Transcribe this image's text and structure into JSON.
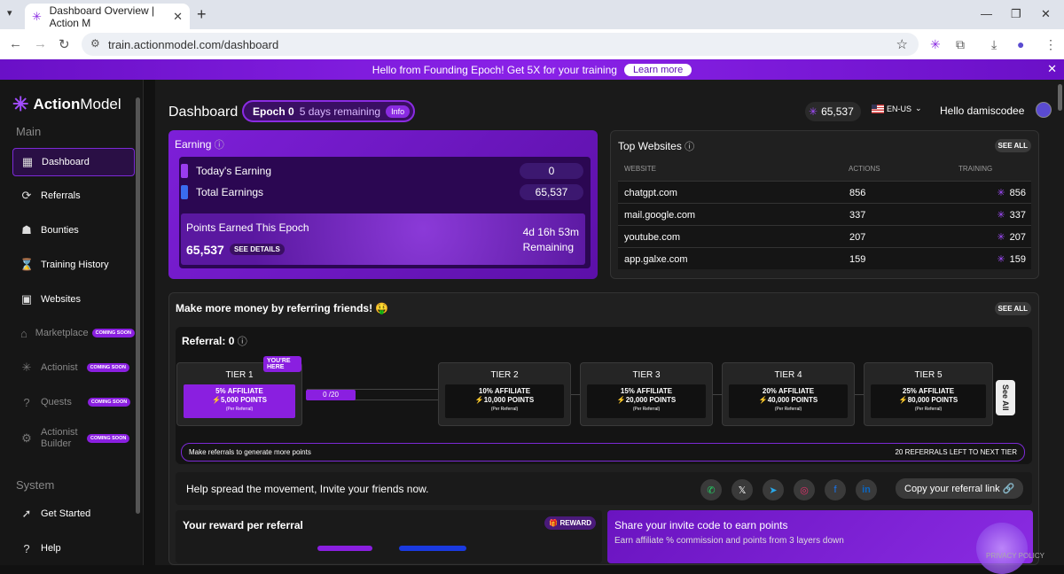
{
  "browser": {
    "tab_title": "Dashboard Overview | Action M",
    "url": "train.actionmodel.com/dashboard"
  },
  "banner": {
    "text": "Hello from Founding Epoch! Get 5X for your training",
    "button": "Learn more"
  },
  "sidebar": {
    "logo_bold": "Action",
    "logo_rest": "Model",
    "section_main": "Main",
    "section_system": "System",
    "items": [
      {
        "label": "Dashboard",
        "icon": "grid-icon"
      },
      {
        "label": "Referrals",
        "icon": "referral-icon"
      },
      {
        "label": "Bounties",
        "icon": "bounty-icon"
      },
      {
        "label": "Training History",
        "icon": "history-icon"
      },
      {
        "label": "Websites",
        "icon": "websites-icon"
      },
      {
        "label": "Marketplace",
        "icon": "market-icon",
        "badge": "COMING SOON"
      },
      {
        "label": "Actionist",
        "icon": "actionist-icon",
        "badge": "COMING SOON"
      },
      {
        "label": "Quests",
        "icon": "quests-icon",
        "badge": "COMING SOON"
      },
      {
        "label": "Actionist Builder",
        "icon": "builder-icon",
        "badge": "COMING SOON"
      },
      {
        "label": "Get Started",
        "icon": "rocket-icon"
      },
      {
        "label": "Help",
        "icon": "help-icon"
      }
    ]
  },
  "header": {
    "title": "Dashboard",
    "epoch_label": "Epoch 0",
    "epoch_remaining": "5 days remaining",
    "epoch_info": "Info",
    "points": "65,537",
    "language": "EN-US",
    "greeting": "Hello damiscodee"
  },
  "earning": {
    "title": "Earning",
    "today_label": "Today's Earning",
    "today_value": "0",
    "total_label": "Total Earnings",
    "total_value": "65,537",
    "epoch_label": "Points Earned This Epoch",
    "epoch_value": "65,537",
    "see_details": "SEE DETAILS",
    "time_left": "4d 16h 53m",
    "remaining": "Remaining"
  },
  "top_websites": {
    "title": "Top Websites",
    "see_all": "SEE ALL",
    "columns": [
      "WEBSITE",
      "ACTIONS",
      "TRAINING"
    ],
    "rows": [
      {
        "site": "chatgpt.com",
        "actions": "856",
        "training": "856"
      },
      {
        "site": "mail.google.com",
        "actions": "337",
        "training": "337"
      },
      {
        "site": "youtube.com",
        "actions": "207",
        "training": "207"
      },
      {
        "site": "app.galxe.com",
        "actions": "159",
        "training": "159"
      }
    ]
  },
  "referral": {
    "title": "Make more money by referring friends! 🤑",
    "see_all": "SEE ALL",
    "count_label": "Referral: 0",
    "you_here": "YOU'RE HERE",
    "progress": "0  /20",
    "see_all_vertical": "See All",
    "tiers": [
      {
        "name": "TIER 1",
        "affiliate": "5% AFFILIATE",
        "points": "5,000 POINTS",
        "per": "(Per Referral)"
      },
      {
        "name": "TIER 2",
        "affiliate": "10% AFFILIATE",
        "points": "10,000 POINTS",
        "per": "(Per Referral)"
      },
      {
        "name": "TIER 3",
        "affiliate": "15% AFFILIATE",
        "points": "20,000 POINTS",
        "per": "(Per Referral)"
      },
      {
        "name": "TIER 4",
        "affiliate": "20% AFFILIATE",
        "points": "40,000 POINTS",
        "per": "(Per Referral)"
      },
      {
        "name": "TIER 5",
        "affiliate": "25% AFFILIATE",
        "points": "80,000 POINTS",
        "per": "(Per Referral)"
      }
    ],
    "bar_left": "Make referrals to generate more points",
    "bar_right": "20 REFERRALS LEFT TO NEXT TIER",
    "spread_text": "Help spread the movement, Invite your friends now.",
    "copy_link": "Copy your referral link",
    "reward_title": "Your reward per referral",
    "reward_badge": "REWARD",
    "invite_title": "Share your invite code to earn points",
    "invite_sub": "Earn affiliate % commission and points from 3 layers down"
  },
  "footer": {
    "privacy": "PRIVACY POLICY"
  },
  "colors": {
    "accent": "#8a1fe0",
    "bg": "#1a1a1a"
  }
}
